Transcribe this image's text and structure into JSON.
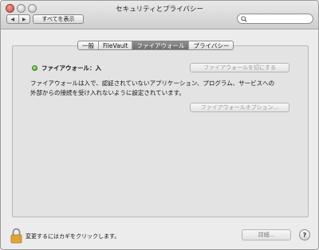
{
  "window": {
    "title": "セキュリティとプライバシー",
    "back_glyph": "◀",
    "forward_glyph": "▶",
    "show_all_label": "すべてを表示",
    "search_placeholder": ""
  },
  "tabs": [
    {
      "label": "一般",
      "active": false
    },
    {
      "label": "FileVault",
      "active": false
    },
    {
      "label": "ファイアウォール",
      "active": true
    },
    {
      "label": "プライバシー",
      "active": false
    }
  ],
  "firewall": {
    "status_text": "ファイアウォール：入",
    "status_color": "#3f9e1f",
    "turn_off_label": "ファイアウォールを切にする",
    "description_line1": "ファイアウォールは入で、認証されていないアプリケーション、プログラム、サービスへの",
    "description_line2": "外部からの接続を受け入れないように設定されています。",
    "options_label": "ファイアウォールオプション..."
  },
  "footer": {
    "lock_text": "変更するにはカギをクリックします。",
    "details_label": "詳細...",
    "help_label": "?"
  }
}
